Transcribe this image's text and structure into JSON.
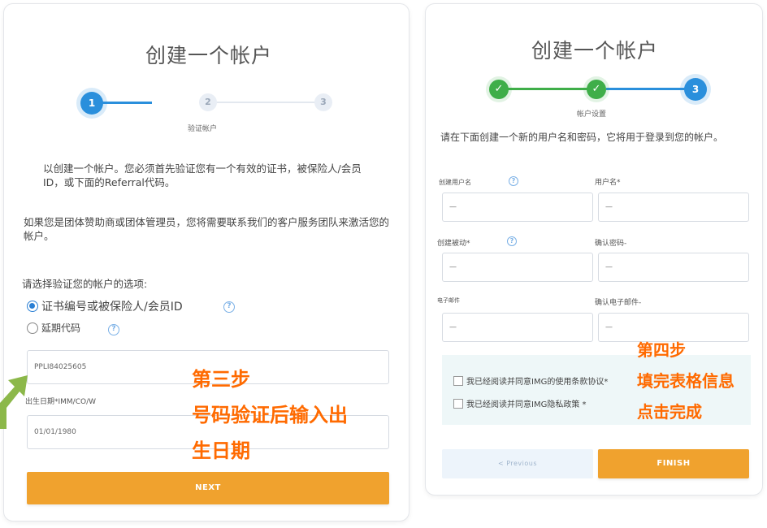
{
  "left": {
    "title": "创建一个帐户",
    "steps": [
      "1",
      "2",
      "3"
    ],
    "step_caption": "验证帐户",
    "intro": "以创建一个帐户。您必须首先验证您有一个有效的证书，被保险人/会员ID，或下面的Referral代码。",
    "group_note": "如果您是团体赞助商或团体管理员，您将需要联系我们的客户服务团队来激活您的帐户。",
    "choose_label": "请选择验证您的帐户的选项:",
    "option_1": "证书编号或被保险人/会员ID",
    "option_2": "延期代码",
    "id_value": "PPLI84025605",
    "dob_label": "出生日期*IMM/CO/W",
    "dob_value": "01/01/1980",
    "next_label": "NEXT",
    "annotation": [
      "第三步",
      "号码验证后输入出",
      "生日期"
    ]
  },
  "right": {
    "title": "创建一个帐户",
    "step_3": "3",
    "step_caption": "帐户设置",
    "intro": "请在下面创建一个新的用户名和密码，它将用于登录到您的帐户。",
    "fields": [
      {
        "label": "创建用户名",
        "value": "—"
      },
      {
        "label": "用户名*",
        "value": "—"
      },
      {
        "label": "创建被动*",
        "value": "—"
      },
      {
        "label": "确认密码-",
        "value": "—"
      },
      {
        "label": "电子邮件",
        "value": "—"
      },
      {
        "label": "确认电子邮件-",
        "value": "—"
      }
    ],
    "terms_1": "我已经阅读并同意IMG的使用条款协议*",
    "terms_2": "我已经阅读并同意IMG隐私政策 *",
    "previous_label": "< Previous",
    "finish_label": "FINISH",
    "annotation": [
      "第四步",
      "填完表格信息",
      "点击完成"
    ]
  },
  "colors": {
    "accent_blue": "#2a8fdc",
    "done_green": "#3fae49",
    "button_orange": "#f0a22e",
    "annotation_orange": "#ff6a00"
  }
}
